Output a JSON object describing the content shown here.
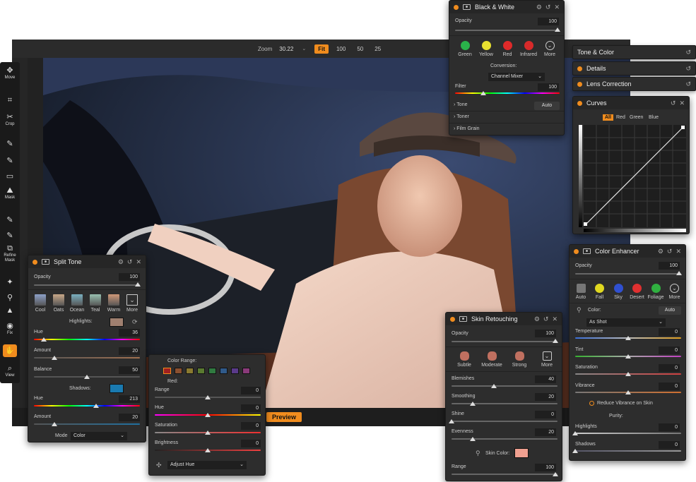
{
  "zoom": {
    "label": "Zoom",
    "value": "30.22",
    "options": [
      "Fit",
      "100",
      "50",
      "25"
    ],
    "active": "Fit"
  },
  "bottom": {
    "preview": "Preview"
  },
  "tools": [
    {
      "icon": "move-icon",
      "glyph": "✥",
      "label": "Move"
    },
    {
      "icon": "crop-icon",
      "glyph": "⌗",
      "label": ""
    },
    {
      "icon": "knife-icon",
      "glyph": "✂",
      "label": "Crop"
    },
    {
      "icon": "brush-icon",
      "glyph": "✎",
      "label": ""
    },
    {
      "icon": "brush-add-icon",
      "glyph": "✎",
      "label": ""
    },
    {
      "icon": "gradient-icon",
      "glyph": "▭",
      "label": ""
    },
    {
      "icon": "mask-icon",
      "glyph": "⛰",
      "label": "Mask"
    },
    {
      "icon": "refine-brush-icon",
      "glyph": "✎",
      "label": ""
    },
    {
      "icon": "refine-brush2-icon",
      "glyph": "✎",
      "label": ""
    },
    {
      "icon": "refine-mask-icon",
      "glyph": "⧉",
      "label": "Refine Mask"
    },
    {
      "icon": "retouch-icon",
      "glyph": "✦",
      "label": ""
    },
    {
      "icon": "dropper-icon",
      "glyph": "⚲",
      "label": ""
    },
    {
      "icon": "stamp-icon",
      "glyph": "▲",
      "label": ""
    },
    {
      "icon": "eye-icon",
      "glyph": "◉",
      "label": "Fix"
    },
    {
      "icon": "hand-icon",
      "glyph": "✋",
      "label": ""
    },
    {
      "icon": "zoom-icon",
      "glyph": "⌕",
      "label": "View"
    }
  ],
  "bw": {
    "title": "Black & White",
    "opacity_label": "Opacity",
    "opacity": "100",
    "presets": [
      {
        "name": "Green",
        "color": "#2ab24a"
      },
      {
        "name": "Yellow",
        "color": "#e8e030"
      },
      {
        "name": "Red",
        "color": "#e02a2a"
      },
      {
        "name": "Infrared",
        "color": "#d82a2a"
      },
      {
        "name": "More",
        "color": ""
      }
    ],
    "conversion_label": "Conversion:",
    "conversion": "Channel Mixer",
    "filter_label": "Filter",
    "filter": "100",
    "rows": [
      "Tone",
      "Toner",
      "Film Grain"
    ],
    "auto": "Auto"
  },
  "sidetabs": [
    {
      "title": "Tone & Color",
      "dot": false
    },
    {
      "title": "Details",
      "dot": true
    },
    {
      "title": "Lens Correction",
      "dot": true
    }
  ],
  "curves": {
    "title": "Curves",
    "tabs": [
      "All",
      "Red",
      "Green",
      "Blue"
    ],
    "active": "All"
  },
  "split": {
    "title": "Split Tone",
    "opacity_label": "Opacity",
    "opacity": "100",
    "presets": [
      {
        "name": "Cool",
        "color": "#8ca0c8"
      },
      {
        "name": "Oats",
        "color": "#c8a888"
      },
      {
        "name": "Ocean",
        "color": "#7ab0c0"
      },
      {
        "name": "Teal",
        "color": "#98c0b0"
      },
      {
        "name": "Warm",
        "color": "#d09878"
      },
      {
        "name": "More",
        "color": ""
      }
    ],
    "highlights_label": "Highlights:",
    "highlights_color": "#a08070",
    "hue_label": "Hue",
    "hue1": "36",
    "amount_label": "Amount",
    "amount1": "20",
    "balance_label": "Balance",
    "balance": "50",
    "shadows_label": "Shadows:",
    "shadows_color": "#1a7ab0",
    "hue2": "213",
    "amount2": "20",
    "mode_label": "Mode",
    "mode": "Color"
  },
  "hsl": {
    "range_label": "Color Range:",
    "colors": [
      "#a02020",
      "#8a5030",
      "#8a7a30",
      "#5a7a30",
      "#307a40",
      "#305a8a",
      "#5a3a8a",
      "#8a3a7a"
    ],
    "red_label": "Red:",
    "sliders": [
      {
        "label": "Range",
        "value": "0"
      },
      {
        "label": "Hue",
        "value": "0"
      },
      {
        "label": "Saturation",
        "value": "0"
      },
      {
        "label": "Brightness",
        "value": "0"
      }
    ],
    "adjust": "Adjust Hue"
  },
  "skin": {
    "title": "Skin Retouching",
    "opacity_label": "Opacity",
    "opacity": "100",
    "presets": [
      "Subtle",
      "Moderate",
      "Strong",
      "More"
    ],
    "sliders": [
      {
        "label": "Blemishes",
        "value": "40"
      },
      {
        "label": "Smoothing",
        "value": "20"
      },
      {
        "label": "Shine",
        "value": "0"
      },
      {
        "label": "Evenness",
        "value": "20"
      }
    ],
    "skin_color_label": "Skin Color:",
    "skin_color": "#f0a090",
    "range_label": "Range",
    "range": "100"
  },
  "enhancer": {
    "title": "Color Enhancer",
    "opacity_label": "Opacity",
    "opacity": "100",
    "presets": [
      {
        "name": "Auto",
        "color": ""
      },
      {
        "name": "Fall",
        "color": "#e0d820"
      },
      {
        "name": "Sky",
        "color": "#3050d0"
      },
      {
        "name": "Desert",
        "color": "#e03030"
      },
      {
        "name": "Foliage",
        "color": "#30b040"
      },
      {
        "name": "More",
        "color": ""
      }
    ],
    "color_label": "Color:",
    "auto": "Auto",
    "as_shot": "As Shot",
    "sliders": [
      {
        "label": "Temperature",
        "value": "0"
      },
      {
        "label": "Tint",
        "value": "0"
      },
      {
        "label": "Saturation",
        "value": "0"
      },
      {
        "label": "Vibrance",
        "value": "0"
      }
    ],
    "reduce": "Reduce Vibrance on Skin",
    "purity_label": "Purity:",
    "purity": [
      {
        "label": "Highlights",
        "value": "0"
      },
      {
        "label": "Shadows",
        "value": "0"
      }
    ]
  }
}
